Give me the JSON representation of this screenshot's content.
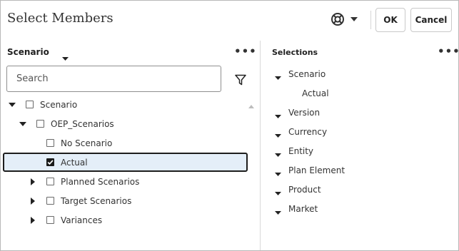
{
  "dialog": {
    "title": "Select Members",
    "ok_label": "OK",
    "cancel_label": "Cancel",
    "help_icon": "help-lifebuoy-icon"
  },
  "members_panel": {
    "dimension": "Scenario",
    "search_placeholder": "Search",
    "tree": [
      {
        "label": "Scenario",
        "level": 0,
        "expander": "expanded",
        "checked": false,
        "selected": false
      },
      {
        "label": "OEP_Scenarios",
        "level": 1,
        "expander": "expanded",
        "checked": false,
        "selected": false
      },
      {
        "label": "No Scenario",
        "level": 2,
        "expander": "none",
        "checked": false,
        "selected": false
      },
      {
        "label": "Actual",
        "level": 2,
        "expander": "none",
        "checked": true,
        "selected": true
      },
      {
        "label": "Planned Scenarios",
        "level": 2,
        "expander": "collapsed",
        "checked": false,
        "selected": false
      },
      {
        "label": "Target Scenarios",
        "level": 2,
        "expander": "collapsed",
        "checked": false,
        "selected": false
      },
      {
        "label": "Variances",
        "level": 2,
        "expander": "collapsed",
        "checked": false,
        "selected": false
      }
    ]
  },
  "selections_panel": {
    "title": "Selections",
    "items": [
      {
        "label": "Scenario",
        "child": false
      },
      {
        "label": "Actual",
        "child": true
      },
      {
        "label": "Version",
        "child": false
      },
      {
        "label": "Currency",
        "child": false
      },
      {
        "label": "Entity",
        "child": false
      },
      {
        "label": "Plan Element",
        "child": false
      },
      {
        "label": "Product",
        "child": false
      },
      {
        "label": "Market",
        "child": false
      }
    ]
  }
}
